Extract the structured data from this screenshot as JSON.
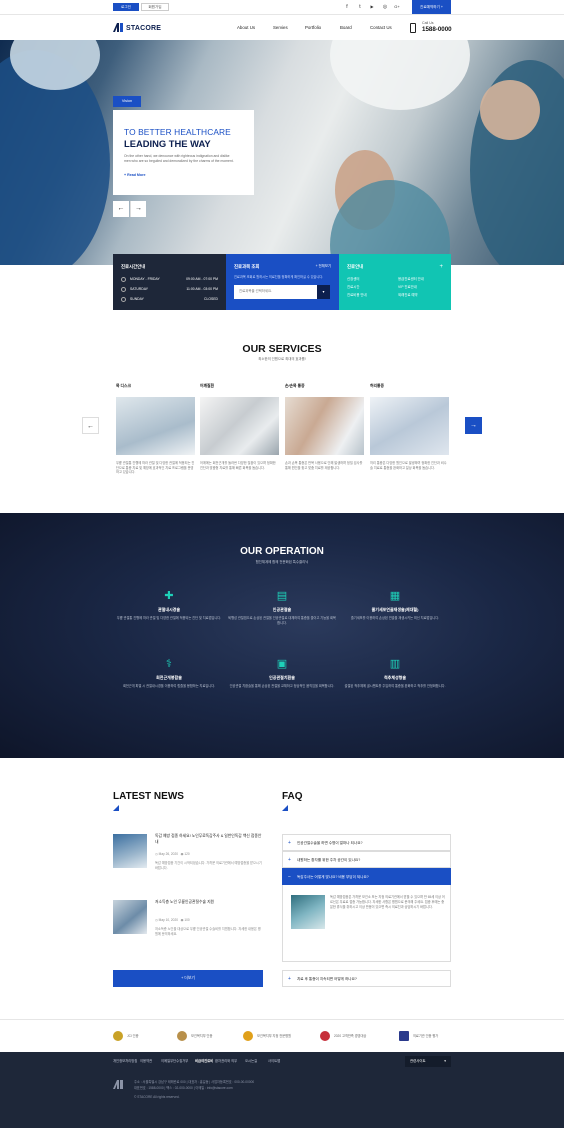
{
  "topbar": {
    "login": "로그인",
    "join": "회원가입",
    "social_icons": [
      "facebook-icon",
      "twitter-icon",
      "youtube-icon",
      "instagram-icon",
      "google-plus-icon"
    ],
    "social_glyphs": [
      "f",
      "t",
      "▶",
      "◎",
      "G+"
    ],
    "request": "진료예약하기 +"
  },
  "header": {
    "logo": "STACORE",
    "nav": [
      "About Us",
      "Servies",
      "Portfolio",
      "Board",
      "Contact Us"
    ],
    "call_label": "Call Us",
    "call_number": "1588-0000"
  },
  "hero": {
    "tab": "Vision",
    "line1": "TO BETTER HEALTHCARE",
    "line2": "LEADING THE WAY",
    "desc": "On the other hand, we denounce with righteous indignation and dislike men who are so beguiled and demoralized by the charms of the moment.",
    "more": "Read More",
    "prev": "←",
    "next": "→"
  },
  "info": {
    "hours_title": "진료시간안내",
    "hours": [
      {
        "day": "MONDAY - FRIDAY",
        "time": "09:00 AM - 07:00 PM"
      },
      {
        "day": "SATURDAY",
        "time": "11:00 AM - 03:00 PM"
      },
      {
        "day": "SUNDAY",
        "time": "CLOSED"
      }
    ],
    "search_title": "진료과목 조회",
    "search_more": "전체보기",
    "search_desc": "진료과목 조회로 원하시는 의료진을 정확하게 확인하실 수 있습니다.",
    "search_placeholder": "진료과목을 선택하세요.",
    "quick_title": "진료안내",
    "quick_links": [
      "신장센터",
      "응급진료센터 안내",
      "진료시간",
      "VIP 진료안내",
      "진료비용 안내",
      "외래진료 예약",
      "진료시간 안내",
      "원격 진료 예약"
    ],
    "plus": "+"
  },
  "services": {
    "title": "OUR SERVICES",
    "subtitle": "최소한의 인원으로 최대의 효과를!",
    "items": [
      {
        "name": "목 디스크",
        "desc": "무릎 관절통 진행에 따라 관절 및 다양한 관절에 적용되는 진단으로 통증 치료 및 예방에 효과적인 치료 프로그램을 운영하고 있습니다."
      },
      {
        "name": "어깨질환",
        "desc": "어깨에는 회전근개를 둘러싼 다양한 질환이 있으며 정확한 진단과 맞춤형 치료를 통해 빠른 회복을 돕습니다."
      },
      {
        "name": "손/손목 통증",
        "desc": "손과 손목 통증은 반복 사용으로 인해 발생하며 정밀 검사를 통해 원인을 찾고 맞춤 치료를 제공합니다."
      },
      {
        "name": "허리통증",
        "desc": "허리 통증은 다양한 원인으로 발생하며 정확한 진단과 비수술 치료로 통증을 완화하고 일상 회복을 돕습니다."
      }
    ],
    "prev": "←",
    "next": "→"
  },
  "operation": {
    "title": "OUR OPERATION",
    "subtitle": "협진체계에 함께 전문화된 특수클리닉",
    "items": [
      {
        "icon": "pills-icon",
        "glyph": "✚",
        "name": "관절내시경술",
        "desc": "무릎 관절통 진행에 따라 관절 및 다양한 관절에 적용되는 진단 및 치료법입니다."
      },
      {
        "icon": "clipboard-icon",
        "glyph": "▤",
        "name": "인공관절술",
        "desc": "퇴행성 관절염으로 손상된 관절을 인공관절로 대체하여 통증을 줄이고 기능을 회복합니다."
      },
      {
        "icon": "document-icon",
        "glyph": "▦",
        "name": "줄기세포연골재생술(제대혈)",
        "desc": "줄기세포를 이용하여 손상된 연골을 재생시키는 최신 치료법입니다."
      },
      {
        "icon": "stethoscope-icon",
        "glyph": "⚕",
        "name": "회전근개봉합술",
        "desc": "회전근개 파열 시 관절내시경을 이용하여 힘줄을 봉합하는 치료입니다."
      },
      {
        "icon": "monitor-icon",
        "glyph": "▣",
        "name": "인공관절치환술",
        "desc": "인공관절 치환술을 통해 손상된 관절을 교체하고 정상적인 움직임을 회복합니다."
      },
      {
        "icon": "hospital-icon",
        "glyph": "▥",
        "name": "척추체성형술",
        "desc": "골절된 척추체에 골시멘트를 주입하여 통증을 완화하고 척추를 안정화합니다."
      }
    ]
  },
  "news": {
    "title": "LATEST NEWS",
    "items": [
      {
        "title": "독감 예방 접종 하세요! 노인무료독감주사 & 일반인독감 백신 접종안내",
        "date": "May 26, 2020",
        "count": "120",
        "desc": "독감 예방접종 기간이 시작되었습니다. 가까운 의료기관에서 예방접종을 받으시기 바랍니다."
      },
      {
        "title": "저소득층 노인 무릎인공관절수술 지원",
        "date": "May 10, 2020",
        "count": "100",
        "desc": "저소득층 노인을 대상으로 무릎 인공관절 수술비를 지원합니다. 자세한 내용은 병원에 문의하세요."
      }
    ],
    "more": "+ 더보기"
  },
  "faq": {
    "title": "FAQ",
    "items": [
      {
        "q": "인공관절수술을 하면 수명이 얼마나 되나요?",
        "open": false
      },
      {
        "q": "내원하는 환자를 위한 주차 공간이 있나요?",
        "open": false
      },
      {
        "q": "독감주사는 어떻게 맞나요? 비용 부담이 되나요?",
        "open": true,
        "a": "독감 예방접종은 가까운 보건소 또는 지정 의료기관에서 받을 수 있으며 만 65세 이상 어르신은 무료로 접종 가능합니다. 자세한 사항은 병원으로 문의해 주세요. 접종 후에는 충분한 휴식을 취하시고 이상 반응이 있으면 즉시 의료진과 상담하시기 바랍니다."
      },
      {
        "q": "치료 후 통증이 지속되면 어떻게 하나요?",
        "open": false
      }
    ]
  },
  "partners": [
    {
      "name": "JCI 인증",
      "color": "#c9a227"
    },
    {
      "name": "보건복지부 인증",
      "color": "#b8904a"
    },
    {
      "name": "보건복지부 지정 전문병원",
      "color": "#e0a01a"
    },
    {
      "name": "2020 고객만족 경영대상",
      "color": "#c62f3a"
    },
    {
      "name": "의료기관 인증 평가",
      "color": "#2a3a8c"
    }
  ],
  "footer": {
    "menu": [
      "개인정보처리방침",
      "이용약관",
      "이메일무단수집거부",
      "비급여진료비",
      "환자권리와 의무",
      "오시는길",
      "사이트맵"
    ],
    "select": "관련사이트",
    "address": "주소 : 서울특별시 강남구 테헤란로 000 | 대표자 : 홍길동 | 사업자등록번호 : 000-00-00000",
    "contact": "대표번호 : 1588-0000 | 팩스 : 02-000-0000 | 이메일 : info@stacore.com",
    "copyright": "© STACORE All rights reserved."
  }
}
